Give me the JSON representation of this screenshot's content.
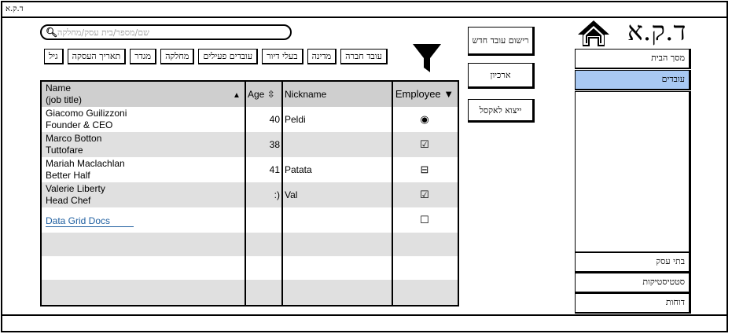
{
  "window": {
    "title": "ד.ק.א"
  },
  "search": {
    "placeholder": "שם/מספר/בית עסק/מחלקה",
    "icon": "search-icon"
  },
  "filters": {
    "chips": [
      "גיל",
      "תאריך העסקה",
      "מגדר",
      "מחלקה",
      "עובדים פעילים",
      "בעלי דיור",
      "מדינה",
      "עובד חברה"
    ],
    "icon": "funnel-icon"
  },
  "grid": {
    "columns": [
      "Name\n(job title)",
      "Age",
      "Nickname",
      "Employee"
    ],
    "rows": [
      {
        "name": "Giacomo Guilizzoni\nFounder & CEO",
        "age": "40",
        "nickname": "Peldi",
        "employee": "◉"
      },
      {
        "name": "Marco Botton\nTuttofare",
        "age": "38",
        "nickname": "",
        "employee": "☑"
      },
      {
        "name": "Mariah Maclachlan\nBetter Half",
        "age": "41",
        "nickname": "Patata",
        "employee": "⊟"
      },
      {
        "name": "Valerie Liberty\nHead Chef",
        "age": ":)",
        "nickname": "Val",
        "employee": "☑"
      }
    ],
    "link_row": {
      "link": "Data Grid Docs",
      "employee": "☐"
    }
  },
  "actions": {
    "register": "רישום עובד חדש",
    "archive": "ארכיון",
    "export": "ייצוא לאקסל"
  },
  "header": {
    "logo_text": "ד.ק.א",
    "home_icon": "home-icon"
  },
  "nav": {
    "items": [
      "מסך הבית",
      "עובדים",
      "בתי עסק",
      "סטטיסטיקות",
      "דוחות"
    ],
    "active": "עובדים",
    "accent_color": "#a9c9f3"
  }
}
